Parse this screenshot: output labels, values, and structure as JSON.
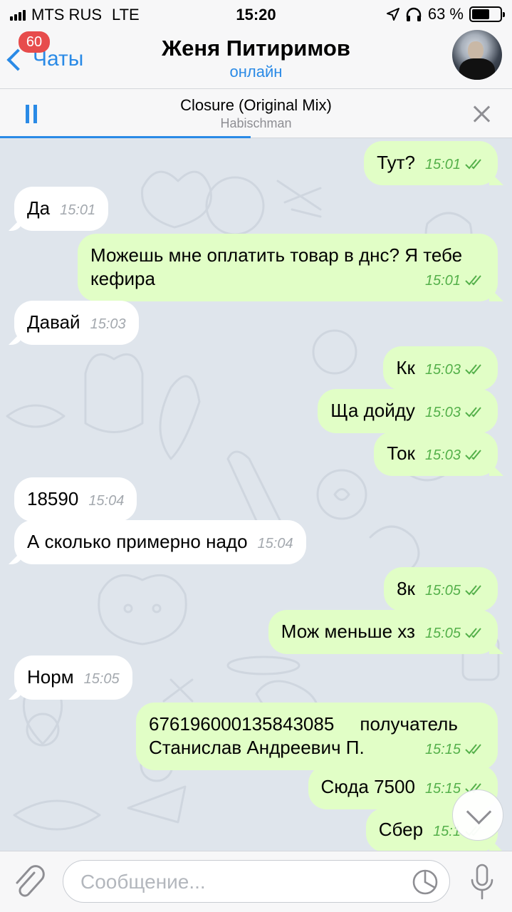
{
  "status_bar": {
    "carrier": "MTS RUS",
    "network": "LTE",
    "time": "15:20",
    "battery": "63 %",
    "battery_level": 0.63,
    "icons": [
      "signal-icon",
      "location-icon",
      "headphones-icon",
      "battery-icon"
    ]
  },
  "header": {
    "back_label": "Чаты",
    "unread_badge": "60",
    "contact_name": "Женя Питиримов",
    "contact_status": "онлайн"
  },
  "player": {
    "title": "Closure (Original Mix)",
    "artist": "Habischman",
    "progress": 0.49
  },
  "messages": [
    {
      "dir": "out",
      "text": "Тут?",
      "time": "15:01"
    },
    {
      "dir": "in",
      "text": "Да",
      "time": "15:01"
    },
    {
      "dir": "out",
      "text": "Можешь мне оплатить товар в днс? Я тебе кефира",
      "line1": "Можешь мне оплатить товар в днс? Я тебе",
      "line2": "кефира",
      "time": "15:01"
    },
    {
      "dir": "in",
      "text": "Давай",
      "time": "15:03"
    },
    {
      "dir": "out",
      "text": "Кк",
      "time": "15:03"
    },
    {
      "dir": "out",
      "text": "Ща дойду",
      "time": "15:03"
    },
    {
      "dir": "out",
      "text": "Ток",
      "time": "15:03"
    },
    {
      "dir": "in",
      "text": "18590",
      "time": "15:04"
    },
    {
      "dir": "in",
      "text": "А сколько примерно надо",
      "time": "15:04"
    },
    {
      "dir": "out",
      "text": "8к",
      "time": "15:05"
    },
    {
      "dir": "out",
      "text": "Мож меньше хз",
      "time": "15:05"
    },
    {
      "dir": "in",
      "text": "Норм",
      "time": "15:05"
    },
    {
      "dir": "out",
      "text": "676196000135843085     получатель Станислав Андреевич П.",
      "line1": "676196000135843085     получатель",
      "line2": "Станислав Андреевич П.",
      "time": "15:15"
    },
    {
      "dir": "out",
      "text": "Сюда 7500",
      "time": "15:15"
    },
    {
      "dir": "out",
      "text": "Сбер",
      "time": "15:1"
    }
  ],
  "input": {
    "placeholder": "Сообщение..."
  },
  "colors": {
    "accent": "#2a8ae6",
    "outgoing_bubble": "#e1fec6",
    "incoming_bubble": "#ffffff",
    "read_check": "#54b04a",
    "badge": "#e74c4c",
    "chat_background": "#dfe5ec"
  }
}
